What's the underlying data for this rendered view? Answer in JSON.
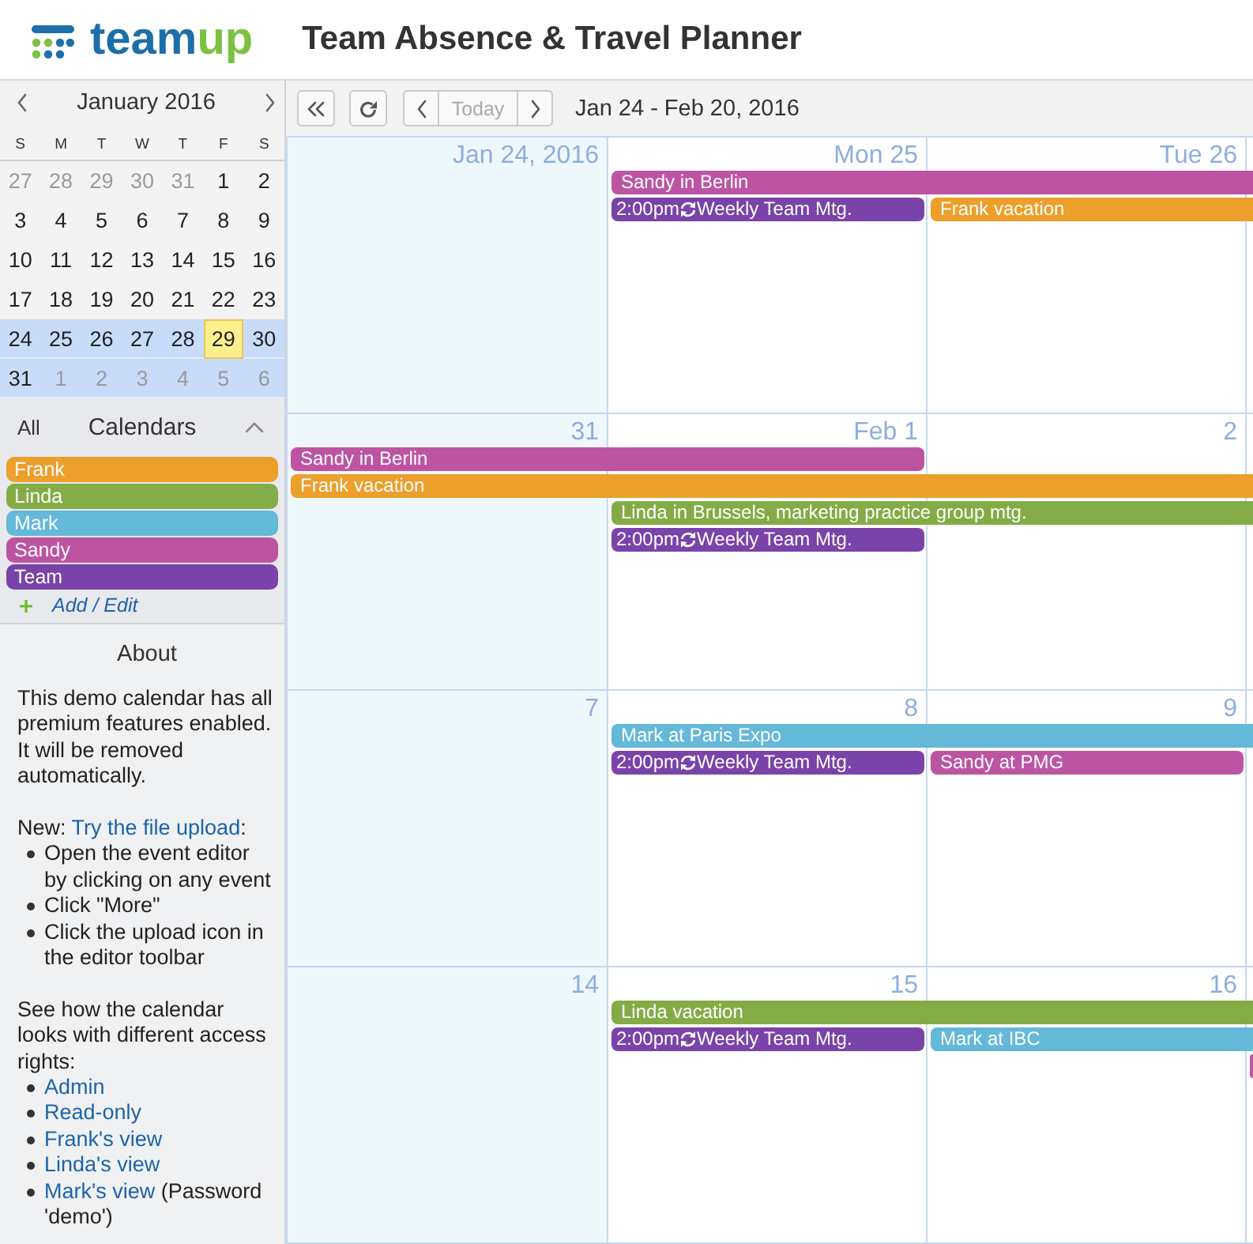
{
  "header": {
    "logo": [
      "team",
      "up"
    ],
    "title": "Team Absence & Travel Planner"
  },
  "mini_calendar": {
    "month": "January 2016",
    "weekdays": [
      "S",
      "M",
      "T",
      "W",
      "T",
      "F",
      "S"
    ],
    "weeks": [
      {
        "in_view": false,
        "days": [
          {
            "label": "27",
            "other_month": true,
            "today": false
          },
          {
            "label": "28",
            "other_month": true,
            "today": false
          },
          {
            "label": "29",
            "other_month": true,
            "today": false
          },
          {
            "label": "30",
            "other_month": true,
            "today": false
          },
          {
            "label": "31",
            "other_month": true,
            "today": false
          },
          {
            "label": "1",
            "other_month": false,
            "today": false
          },
          {
            "label": "2",
            "other_month": false,
            "today": false
          }
        ]
      },
      {
        "in_view": false,
        "days": [
          {
            "label": "3",
            "other_month": false,
            "today": false
          },
          {
            "label": "4",
            "other_month": false,
            "today": false
          },
          {
            "label": "5",
            "other_month": false,
            "today": false
          },
          {
            "label": "6",
            "other_month": false,
            "today": false
          },
          {
            "label": "7",
            "other_month": false,
            "today": false
          },
          {
            "label": "8",
            "other_month": false,
            "today": false
          },
          {
            "label": "9",
            "other_month": false,
            "today": false
          }
        ]
      },
      {
        "in_view": false,
        "days": [
          {
            "label": "10",
            "other_month": false,
            "today": false
          },
          {
            "label": "11",
            "other_month": false,
            "today": false
          },
          {
            "label": "12",
            "other_month": false,
            "today": false
          },
          {
            "label": "13",
            "other_month": false,
            "today": false
          },
          {
            "label": "14",
            "other_month": false,
            "today": false
          },
          {
            "label": "15",
            "other_month": false,
            "today": false
          },
          {
            "label": "16",
            "other_month": false,
            "today": false
          }
        ]
      },
      {
        "in_view": false,
        "days": [
          {
            "label": "17",
            "other_month": false,
            "today": false
          },
          {
            "label": "18",
            "other_month": false,
            "today": false
          },
          {
            "label": "19",
            "other_month": false,
            "today": false
          },
          {
            "label": "20",
            "other_month": false,
            "today": false
          },
          {
            "label": "21",
            "other_month": false,
            "today": false
          },
          {
            "label": "22",
            "other_month": false,
            "today": false
          },
          {
            "label": "23",
            "other_month": false,
            "today": false
          }
        ]
      },
      {
        "in_view": true,
        "days": [
          {
            "label": "24",
            "other_month": false,
            "today": false
          },
          {
            "label": "25",
            "other_month": false,
            "today": false
          },
          {
            "label": "26",
            "other_month": false,
            "today": false
          },
          {
            "label": "27",
            "other_month": false,
            "today": false
          },
          {
            "label": "28",
            "other_month": false,
            "today": false
          },
          {
            "label": "29",
            "other_month": false,
            "today": true
          },
          {
            "label": "30",
            "other_month": false,
            "today": false
          }
        ]
      },
      {
        "in_view": true,
        "days": [
          {
            "label": "31",
            "other_month": false,
            "today": false
          },
          {
            "label": "1",
            "other_month": true,
            "today": false
          },
          {
            "label": "2",
            "other_month": true,
            "today": false
          },
          {
            "label": "3",
            "other_month": true,
            "today": false
          },
          {
            "label": "4",
            "other_month": true,
            "today": false
          },
          {
            "label": "5",
            "other_month": true,
            "today": false
          },
          {
            "label": "6",
            "other_month": true,
            "today": false
          }
        ]
      }
    ]
  },
  "calendars": {
    "all_label": "All",
    "title": "Calendars",
    "expanded": true,
    "items": [
      {
        "name": "Frank",
        "color": "#ec9f2b"
      },
      {
        "name": "Linda",
        "color": "#84ac46"
      },
      {
        "name": "Mark",
        "color": "#64b8d8"
      },
      {
        "name": "Sandy",
        "color": "#bd54a3"
      },
      {
        "name": "Team",
        "color": "#7943a9"
      }
    ],
    "add_label": "Add / Edit"
  },
  "about": {
    "title": "About",
    "sections": [
      {
        "parts": [
          {
            "text": "This demo calendar has all premium features enabled. It will be removed automatically.",
            "link": false
          }
        ]
      },
      {
        "parts": [
          {
            "text": "New: ",
            "link": false
          },
          {
            "text": "Try the file upload",
            "link": true
          },
          {
            "text": ":",
            "link": false
          }
        ],
        "bullets": [
          {
            "parts": [
              {
                "text": "Open the event editor by clicking on any event",
                "link": false
              }
            ]
          },
          {
            "parts": [
              {
                "text": "Click \"More\"",
                "link": false
              }
            ]
          },
          {
            "parts": [
              {
                "text": "Click the upload icon in the editor toolbar",
                "link": false
              }
            ]
          }
        ]
      },
      {
        "parts": [
          {
            "text": "See how the calendar looks with different access rights:",
            "link": false
          }
        ],
        "bullets": [
          {
            "parts": [
              {
                "text": "Admin",
                "link": true
              }
            ]
          },
          {
            "parts": [
              {
                "text": "Read-only",
                "link": true
              }
            ]
          },
          {
            "parts": [
              {
                "text": "Frank's view",
                "link": true
              }
            ]
          },
          {
            "parts": [
              {
                "text": "Linda's view",
                "link": true
              }
            ]
          },
          {
            "parts": [
              {
                "text": "Mark's view",
                "link": true
              },
              {
                "text": " (Password 'demo')",
                "link": false
              }
            ]
          }
        ]
      }
    ]
  },
  "toolbar": {
    "buttons": [
      {
        "kind": "collapse",
        "disabled": false
      },
      {
        "kind": "refresh",
        "disabled": false
      }
    ],
    "nav": [
      {
        "kind": "prev",
        "disabled": false
      },
      {
        "kind": "today",
        "label": "Today",
        "disabled": true
      },
      {
        "kind": "next",
        "disabled": false
      }
    ],
    "range": "Jan 24 - Feb 20, 2016"
  },
  "weeks": [
    {
      "days": [
        {
          "label": "Jan 24, 2016",
          "weekend": true
        },
        {
          "label": "Mon 25",
          "weekend": false
        },
        {
          "label": "Tue 26",
          "weekend": false
        }
      ],
      "lanes": [
        {
          "slots": [
            {
              "kind": "blank"
            },
            {
              "kind": "start",
              "title": "Sandy in Berlin",
              "recurring": false,
              "color": "#bd54a3"
            },
            {
              "kind": "cont"
            },
            {
              "kind": "cont"
            }
          ]
        },
        {
          "slots": [
            {
              "kind": "blank"
            },
            {
              "kind": "start",
              "time": "2:00pm",
              "title": "Weekly Team Mtg.",
              "recurring": true,
              "color": "#7943a9"
            },
            {
              "kind": "start",
              "title": "Frank vacation",
              "recurring": false,
              "color": "#ec9f2b"
            },
            {
              "kind": "cont"
            }
          ]
        }
      ]
    },
    {
      "days": [
        {
          "label": "31",
          "weekend": true
        },
        {
          "label": "Feb 1",
          "weekend": false
        },
        {
          "label": "2",
          "weekend": false
        }
      ],
      "lanes": [
        {
          "slots": [
            {
              "kind": "start",
              "title": "Sandy in Berlin",
              "recurring": false,
              "color": "#bd54a3"
            },
            {
              "kind": "cont"
            },
            {
              "kind": "blank"
            },
            {
              "kind": "blank"
            }
          ]
        },
        {
          "slots": [
            {
              "kind": "start",
              "title": "Frank vacation",
              "recurring": false,
              "color": "#ec9f2b"
            },
            {
              "kind": "cont"
            },
            {
              "kind": "cont"
            },
            {
              "kind": "cont"
            }
          ]
        },
        {
          "slots": [
            {
              "kind": "blank"
            },
            {
              "kind": "start",
              "title": "Linda in Brussels, marketing practice group mtg.",
              "recurring": false,
              "color": "#84ac46"
            },
            {
              "kind": "cont"
            },
            {
              "kind": "cont"
            }
          ]
        },
        {
          "slots": [
            {
              "kind": "blank"
            },
            {
              "kind": "start",
              "time": "2:00pm",
              "title": "Weekly Team Mtg.",
              "recurring": true,
              "color": "#7943a9"
            },
            {
              "kind": "blank"
            },
            {
              "kind": "blank"
            }
          ]
        }
      ]
    },
    {
      "days": [
        {
          "label": "7",
          "weekend": true
        },
        {
          "label": "8",
          "weekend": false
        },
        {
          "label": "9",
          "weekend": false
        }
      ],
      "lanes": [
        {
          "slots": [
            {
              "kind": "blank"
            },
            {
              "kind": "start",
              "title": "Mark at Paris Expo",
              "recurring": false,
              "color": "#64b8d8"
            },
            {
              "kind": "cont"
            },
            {
              "kind": "cont"
            }
          ]
        },
        {
          "slots": [
            {
              "kind": "blank"
            },
            {
              "kind": "start",
              "time": "2:00pm",
              "title": "Weekly Team Mtg.",
              "recurring": true,
              "color": "#7943a9"
            },
            {
              "kind": "start",
              "title": "Sandy at PMG",
              "recurring": false,
              "color": "#bd54a3"
            },
            {
              "kind": "blank"
            }
          ]
        }
      ]
    },
    {
      "days": [
        {
          "label": "14",
          "weekend": true
        },
        {
          "label": "15",
          "weekend": false
        },
        {
          "label": "16",
          "weekend": false
        }
      ],
      "lanes": [
        {
          "slots": [
            {
              "kind": "blank"
            },
            {
              "kind": "start",
              "title": "Linda vacation",
              "recurring": false,
              "color": "#84ac46"
            },
            {
              "kind": "cont"
            },
            {
              "kind": "cont"
            }
          ]
        },
        {
          "slots": [
            {
              "kind": "blank"
            },
            {
              "kind": "start",
              "time": "2:00pm",
              "title": "Weekly Team Mtg.",
              "recurring": true,
              "color": "#7943a9"
            },
            {
              "kind": "start",
              "title": "Mark at IBC",
              "recurring": false,
              "color": "#64b8d8"
            },
            {
              "kind": "cont"
            }
          ]
        },
        {
          "slots": [
            {
              "kind": "blank"
            },
            {
              "kind": "blank"
            },
            {
              "kind": "blank"
            },
            {
              "kind": "start",
              "recurring": false,
              "color": "#bd54a3"
            }
          ]
        }
      ]
    }
  ]
}
